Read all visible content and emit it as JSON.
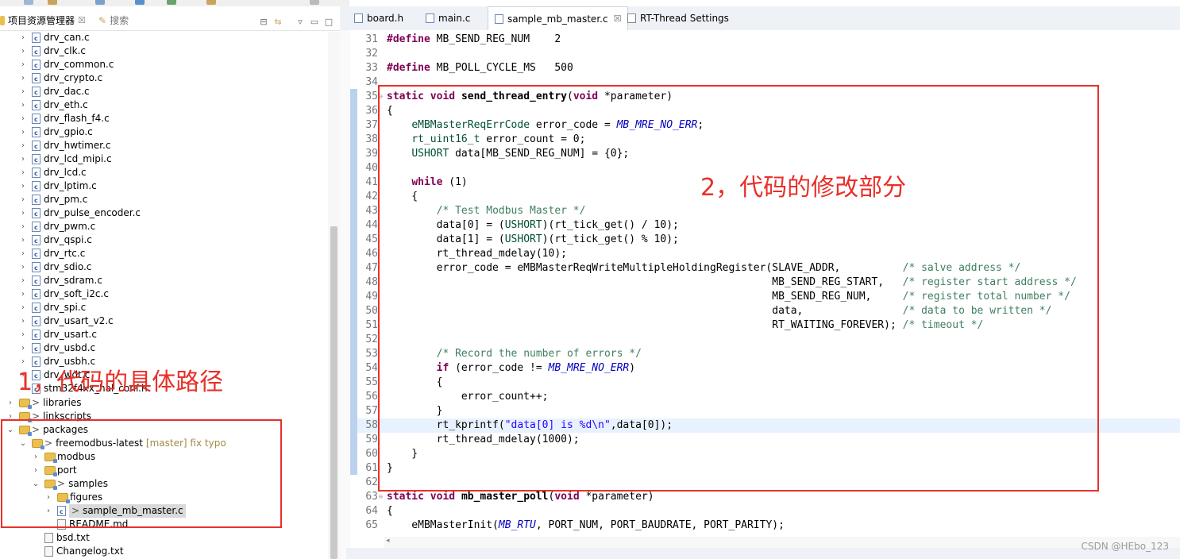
{
  "left_panel": {
    "tab_explorer": "项目资源管理器",
    "tab_close": "☒",
    "tab_search": "搜索"
  },
  "tree": {
    "files": [
      "drv_can.c",
      "drv_clk.c",
      "drv_common.c",
      "drv_crypto.c",
      "drv_dac.c",
      "drv_eth.c",
      "drv_flash_f4.c",
      "drv_gpio.c",
      "drv_hwtimer.c",
      "drv_lcd_mipi.c",
      "drv_lcd.c",
      "drv_lptim.c",
      "drv_pm.c",
      "drv_pulse_encoder.c",
      "drv_pwm.c",
      "drv_qspi.c",
      "drv_rtc.c",
      "drv_sdio.c",
      "drv_sdram.c",
      "drv_soft_i2c.c",
      "drv_spi.c",
      "drv_usart_v2.c",
      "drv_usart.c",
      "drv_usbd.c",
      "drv_usbh.c",
      "drv_wdt.c",
      "stm32f4xx_hal_conf.h"
    ],
    "libraries": "libraries",
    "linkscripts": "linkscripts",
    "packages": "packages",
    "freemodbus": "freemodbus-latest",
    "freemodbus_git": "[master] fix typo",
    "modbus": "modbus",
    "port": "port",
    "samples": "samples",
    "figures": "figures",
    "sample_file": "sample_mb_master.c",
    "readme": "README.md",
    "bsd": "bsd.txt",
    "changelog": "Changelog.txt"
  },
  "annotations": {
    "left": "1，代码的具体路径",
    "right": "2，代码的修改部分"
  },
  "editor_tabs": [
    {
      "label": "board.h"
    },
    {
      "label": "main.c"
    },
    {
      "label": "sample_mb_master.c",
      "close": "☒"
    },
    {
      "label": "RT-Thread Settings"
    }
  ],
  "code_lines": [
    {
      "n": "31",
      "t": "#define MB_SEND_REG_NUM    2"
    },
    {
      "n": "32",
      "t": ""
    },
    {
      "n": "33",
      "t": "#define MB_POLL_CYCLE_MS   500"
    },
    {
      "n": "34",
      "t": ""
    },
    {
      "n": "35",
      "t": "static void send_thread_entry(void *parameter)"
    },
    {
      "n": "36",
      "t": "{"
    },
    {
      "n": "37",
      "t": "    eMBMasterReqErrCode error_code = MB_MRE_NO_ERR;"
    },
    {
      "n": "38",
      "t": "    rt_uint16_t error_count = 0;"
    },
    {
      "n": "39",
      "t": "    USHORT data[MB_SEND_REG_NUM] = {0};"
    },
    {
      "n": "40",
      "t": ""
    },
    {
      "n": "41",
      "t": "    while (1)"
    },
    {
      "n": "42",
      "t": "    {"
    },
    {
      "n": "43",
      "t": "        /* Test Modbus Master */"
    },
    {
      "n": "44",
      "t": "        data[0] = (USHORT)(rt_tick_get() / 10);"
    },
    {
      "n": "45",
      "t": "        data[1] = (USHORT)(rt_tick_get() % 10);"
    },
    {
      "n": "46",
      "t": "        rt_thread_mdelay(10);"
    },
    {
      "n": "47",
      "t": "        error_code = eMBMasterReqWriteMultipleHoldingRegister(SLAVE_ADDR,          /* salve address */"
    },
    {
      "n": "48",
      "t": "                                                              MB_SEND_REG_START,   /* register start address */"
    },
    {
      "n": "49",
      "t": "                                                              MB_SEND_REG_NUM,     /* register total number */"
    },
    {
      "n": "50",
      "t": "                                                              data,                /* data to be written */"
    },
    {
      "n": "51",
      "t": "                                                              RT_WAITING_FOREVER); /* timeout */"
    },
    {
      "n": "52",
      "t": ""
    },
    {
      "n": "53",
      "t": "        /* Record the number of errors */"
    },
    {
      "n": "54",
      "t": "        if (error_code != MB_MRE_NO_ERR)"
    },
    {
      "n": "55",
      "t": "        {"
    },
    {
      "n": "56",
      "t": "            error_count++;"
    },
    {
      "n": "57",
      "t": "        }"
    },
    {
      "n": "58",
      "t": "        rt_kprintf(\"data[0] is %d\\n\",data[0]);"
    },
    {
      "n": "59",
      "t": "        rt_thread_mdelay(1000);"
    },
    {
      "n": "60",
      "t": "    }"
    },
    {
      "n": "61",
      "t": "}"
    },
    {
      "n": "62",
      "t": ""
    },
    {
      "n": "63",
      "t": "static void mb_master_poll(void *parameter)"
    },
    {
      "n": "64",
      "t": "{"
    },
    {
      "n": "65",
      "t": "    eMBMasterInit(MB_RTU, PORT_NUM, PORT_BAUDRATE, PORT_PARITY);"
    }
  ],
  "watermark": "CSDN @HEbo_123",
  "colors": {
    "annotation_red": "#e8302a",
    "keyword": "#7f0055",
    "comment": "#3f7f5f",
    "string": "#2a00ff",
    "enum": "#0000c0"
  }
}
